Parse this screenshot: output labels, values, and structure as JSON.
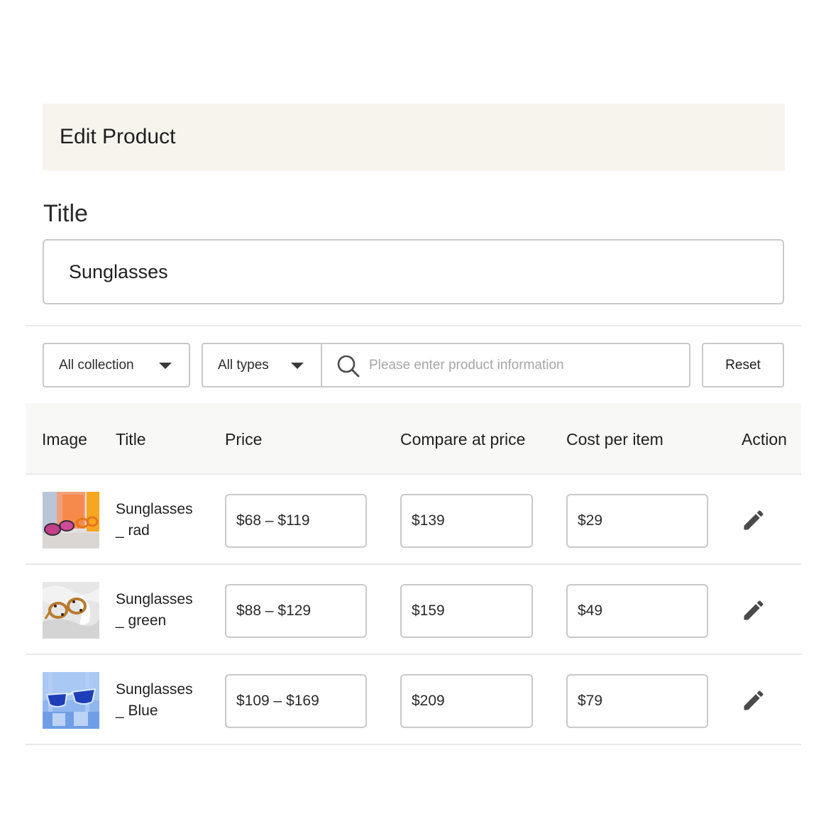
{
  "header": {
    "title": "Edit Product"
  },
  "form": {
    "title_label": "Title",
    "title_value": "Sunglasses"
  },
  "filters": {
    "collection_select": "All collection",
    "type_select": "All types",
    "search_placeholder": "Please enter product information",
    "reset_label": "Reset"
  },
  "table": {
    "columns": [
      "Image",
      "Title",
      "Price",
      "Compare at price",
      "Cost per item",
      "Action"
    ],
    "rows": [
      {
        "title_line1": "Sunglasses",
        "title_line2": "_ rad",
        "price": "$68 – $119",
        "compare_at_price": "$139",
        "cost_per_item": "$29",
        "image": "red-sunglasses-photo"
      },
      {
        "title_line1": "Sunglasses",
        "title_line2": "_ green",
        "price": "$88 – $129",
        "compare_at_price": "$159",
        "cost_per_item": "$49",
        "image": "tortoiseshell-glasses-photo"
      },
      {
        "title_line1": "Sunglasses",
        "title_line2": "_ Blue",
        "price": "$109 – $169",
        "compare_at_price": "$209",
        "cost_per_item": "$79",
        "image": "blue-sunglasses-photo"
      }
    ]
  },
  "icons": {
    "select_caret": "caret-down-icon",
    "search": "search-icon",
    "edit": "pencil-icon"
  },
  "colors": {
    "header_background": "#f7f4ee",
    "border": "#c9c9c9",
    "table_header_background": "#f8f8f7",
    "icon": "#4a4a4a"
  }
}
